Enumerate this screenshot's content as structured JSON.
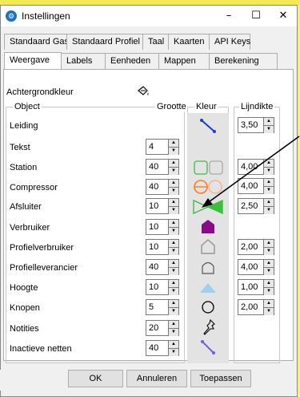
{
  "window": {
    "title": "Instellingen",
    "minimize": "–",
    "maximize": "☐",
    "close": "✕"
  },
  "tabs_row1": [
    "Standaard Gas",
    "Standaard Profiel",
    "Taal",
    "Kaarten",
    "API Keys"
  ],
  "tabs_row2": [
    "Weergave",
    "Labels",
    "Eenheden",
    "Mappen",
    "Berekening"
  ],
  "active_tab": "Weergave",
  "background_label": "Achtergrondkleur",
  "headers": {
    "object": "Object",
    "size": "Grootte",
    "color": "Kleur",
    "linewidth": "Lijndikte"
  },
  "rows": [
    {
      "name": "Leiding",
      "size": "",
      "linewidth": "3,50",
      "icon": "line-segment-icon"
    },
    {
      "name": "Tekst",
      "size": "4",
      "linewidth": "",
      "icon": ""
    },
    {
      "name": "Station",
      "size": "40",
      "linewidth": "4,00",
      "icon": "station-icon"
    },
    {
      "name": "Compressor",
      "size": "40",
      "linewidth": "4,00",
      "icon": "compressor-icon"
    },
    {
      "name": "Afsluiter",
      "size": "10",
      "linewidth": "2,50",
      "icon": "valve-icon"
    },
    {
      "name": "Verbruiker",
      "size": "10",
      "linewidth": "",
      "icon": "consumer-icon"
    },
    {
      "name": "Profielverbruiker",
      "size": "10",
      "linewidth": "2,00",
      "icon": "profile-consumer-icon"
    },
    {
      "name": "Profielleverancier",
      "size": "40",
      "linewidth": "4,00",
      "icon": "profile-supplier-icon"
    },
    {
      "name": "Hoogte",
      "size": "10",
      "linewidth": "1,00",
      "icon": "height-icon"
    },
    {
      "name": "Knopen",
      "size": "5",
      "linewidth": "2,00",
      "icon": "node-icon"
    },
    {
      "name": "Notities",
      "size": "20",
      "linewidth": "",
      "icon": "pin-icon"
    },
    {
      "name": "Inactieve netten",
      "size": "40",
      "linewidth": "",
      "icon": "inactive-line-icon"
    }
  ],
  "buttons": {
    "ok": "OK",
    "cancel": "Annuleren",
    "apply": "Toepassen"
  },
  "colors": {
    "line": "#1a3fbf",
    "green": "#3cc03c",
    "orange": "#ff7a1a",
    "purple": "#8a0a8a",
    "light_blue": "#9ed0f0",
    "inactive": "#7a5ae0"
  }
}
